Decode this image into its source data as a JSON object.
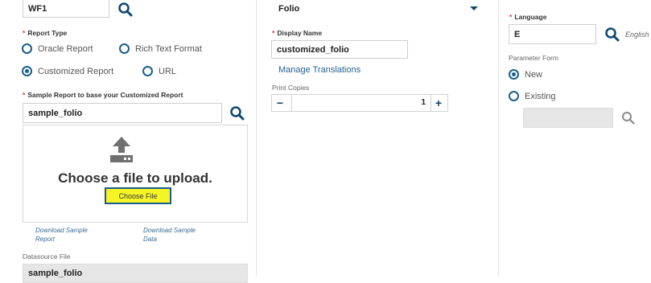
{
  "left": {
    "wf_value": "WF1",
    "report_type_label": "Report Type",
    "report_type_options": [
      "Oracle Report",
      "Rich Text Format",
      "Customized Report",
      "URL"
    ],
    "selected_report_type": "Customized Report",
    "sample_report_label": "Sample Report to base your Customized Report",
    "sample_report_value": "sample_folio",
    "upload_text": "Choose a file to upload.",
    "choose_file_label": "Choose File",
    "download_sample_report": [
      "Download Sample",
      "Report"
    ],
    "download_sample_data": [
      "Download Sample",
      "Data"
    ],
    "datasource_label": "Datasource File",
    "datasource_value": "sample_folio"
  },
  "middle": {
    "folio_value": "Folio",
    "display_name_label": "Display Name",
    "display_name_value": "customized_folio",
    "manage_translations": "Manage Translations",
    "print_copies_label": "Print Copies",
    "print_copies_value": "1"
  },
  "right": {
    "language_label": "Language",
    "language_value": "E",
    "language_hint": "English",
    "parameter_form_label": "Parameter Form",
    "parameter_form_options": [
      "New",
      "Existing"
    ],
    "selected_parameter_form": "New"
  },
  "colors": {
    "accent": "#1b5e8a",
    "required": "#d9312b",
    "highlight": "#f5f526"
  },
  "icons": [
    "search-icon",
    "upload-icon",
    "chevron-down-icon",
    "minus-icon",
    "plus-icon",
    "radio-selected-icon",
    "radio-unselected-icon"
  ]
}
